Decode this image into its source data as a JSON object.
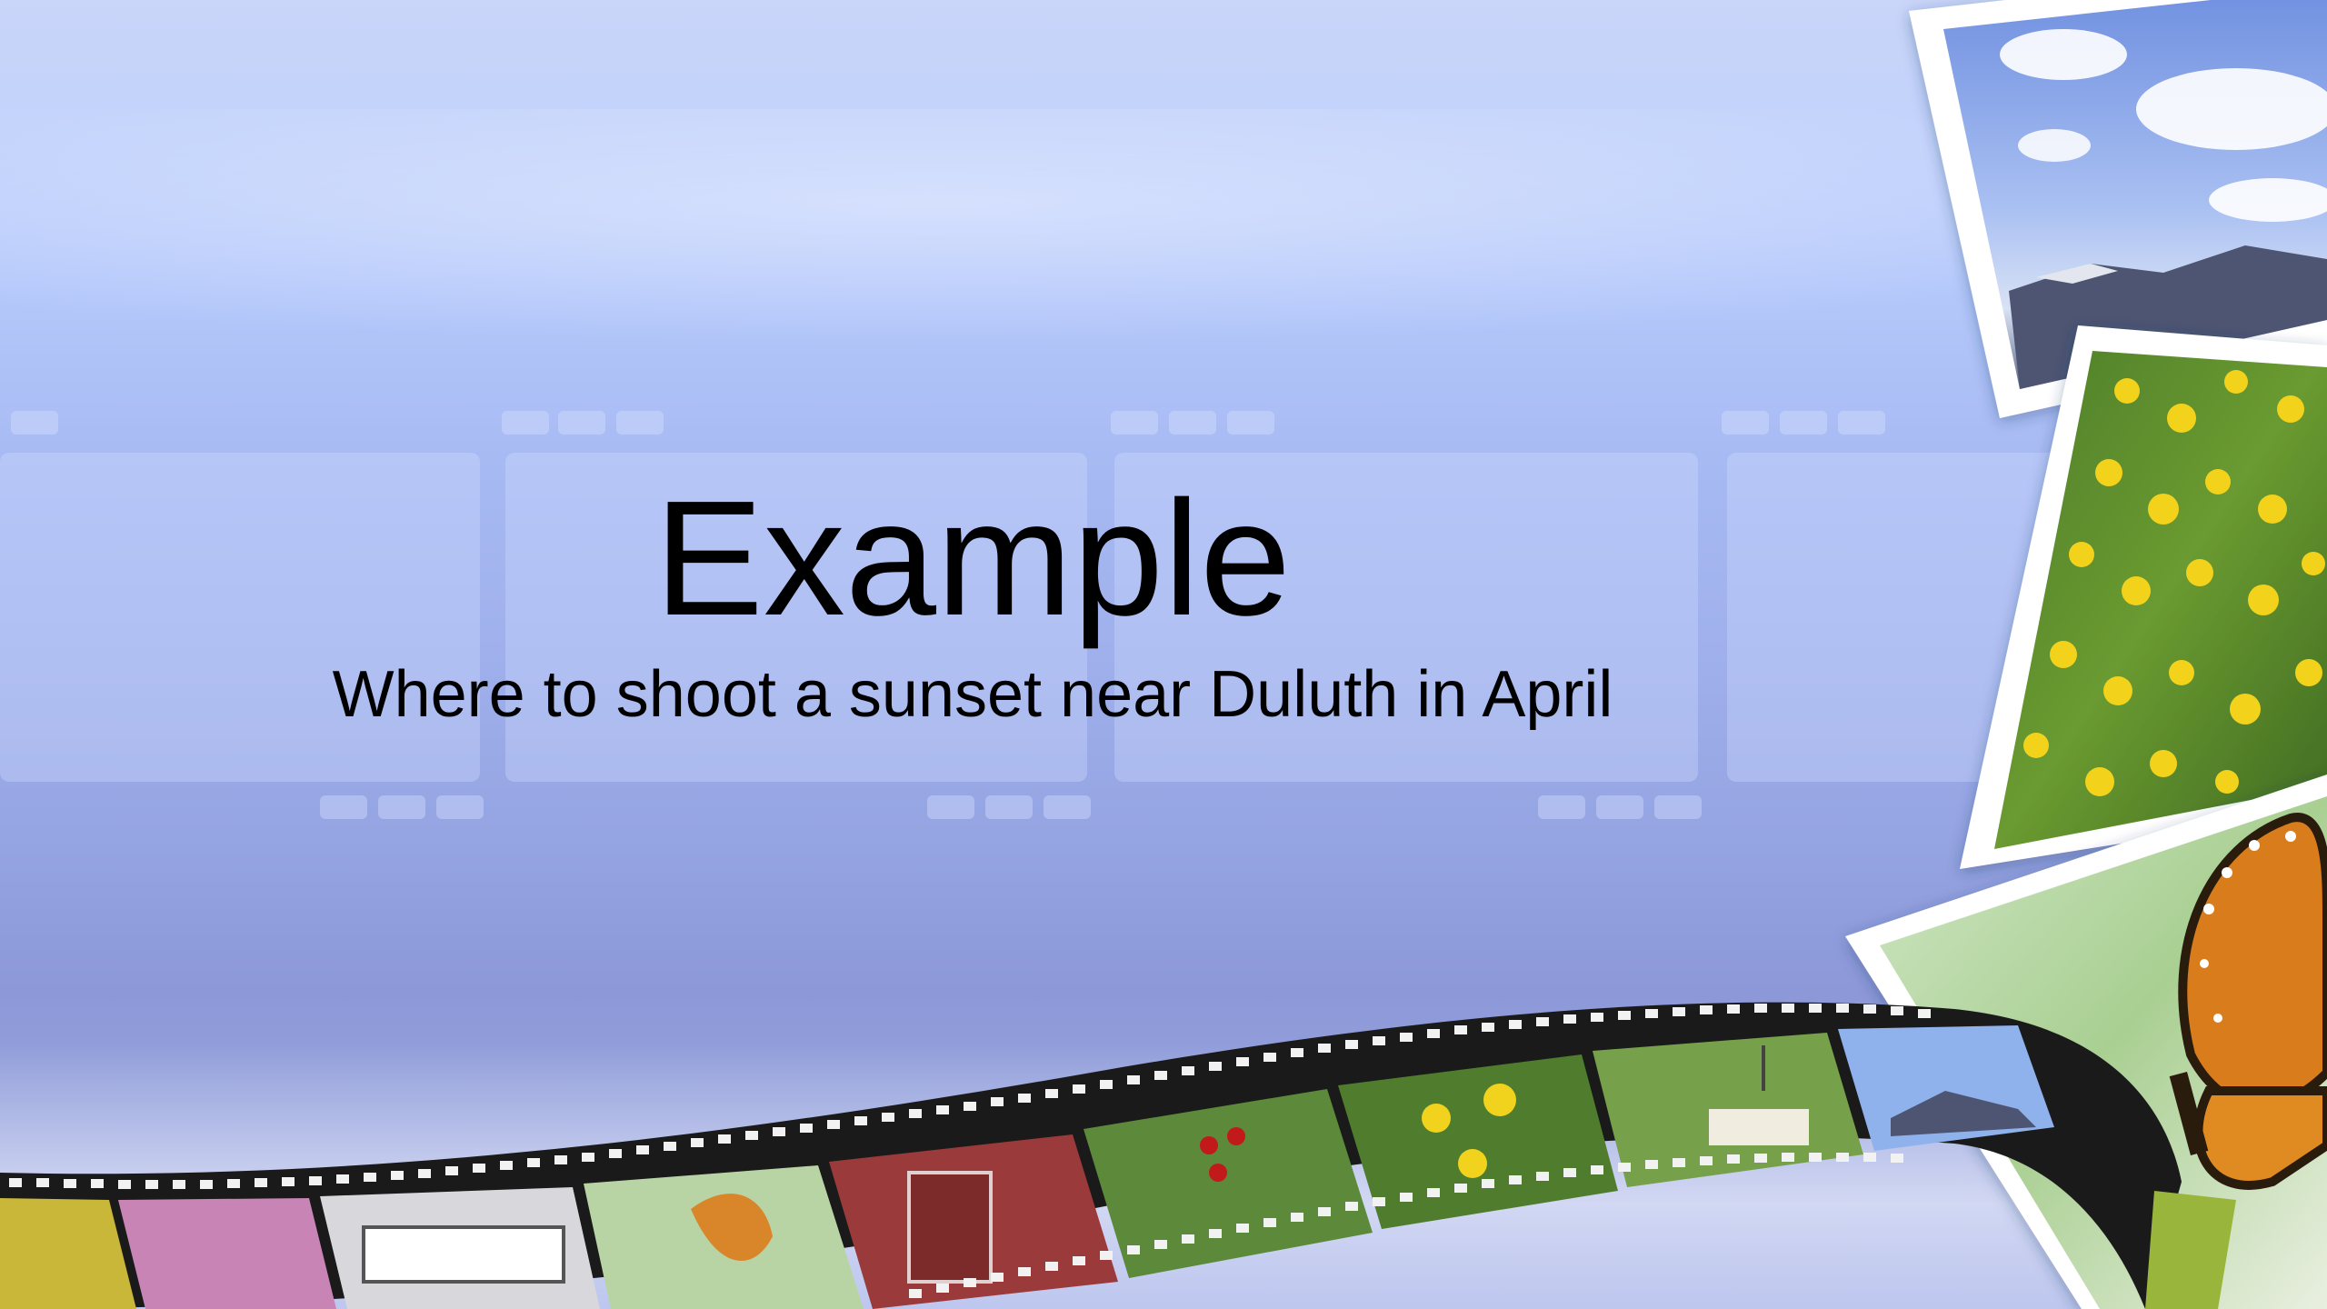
{
  "slide": {
    "title": "Example",
    "subtitle": "Where to shoot a sunset near Duluth in April"
  },
  "colors": {
    "background_top": "#c9d5f9",
    "background_bottom": "#8c98d8",
    "text": "#000000",
    "film": "#1a1a1a"
  },
  "decorations": {
    "photos": [
      "mountain-sky-photo",
      "yellow-flowers-photo",
      "monarch-butterfly-photo"
    ],
    "film_frames": [
      "yellow-flower",
      "pink-flowers",
      "bus",
      "butterfly",
      "red-barn",
      "red-berries",
      "yellow-flowers",
      "grave-marker-flag",
      "sky-mountains",
      "flowers"
    ]
  }
}
